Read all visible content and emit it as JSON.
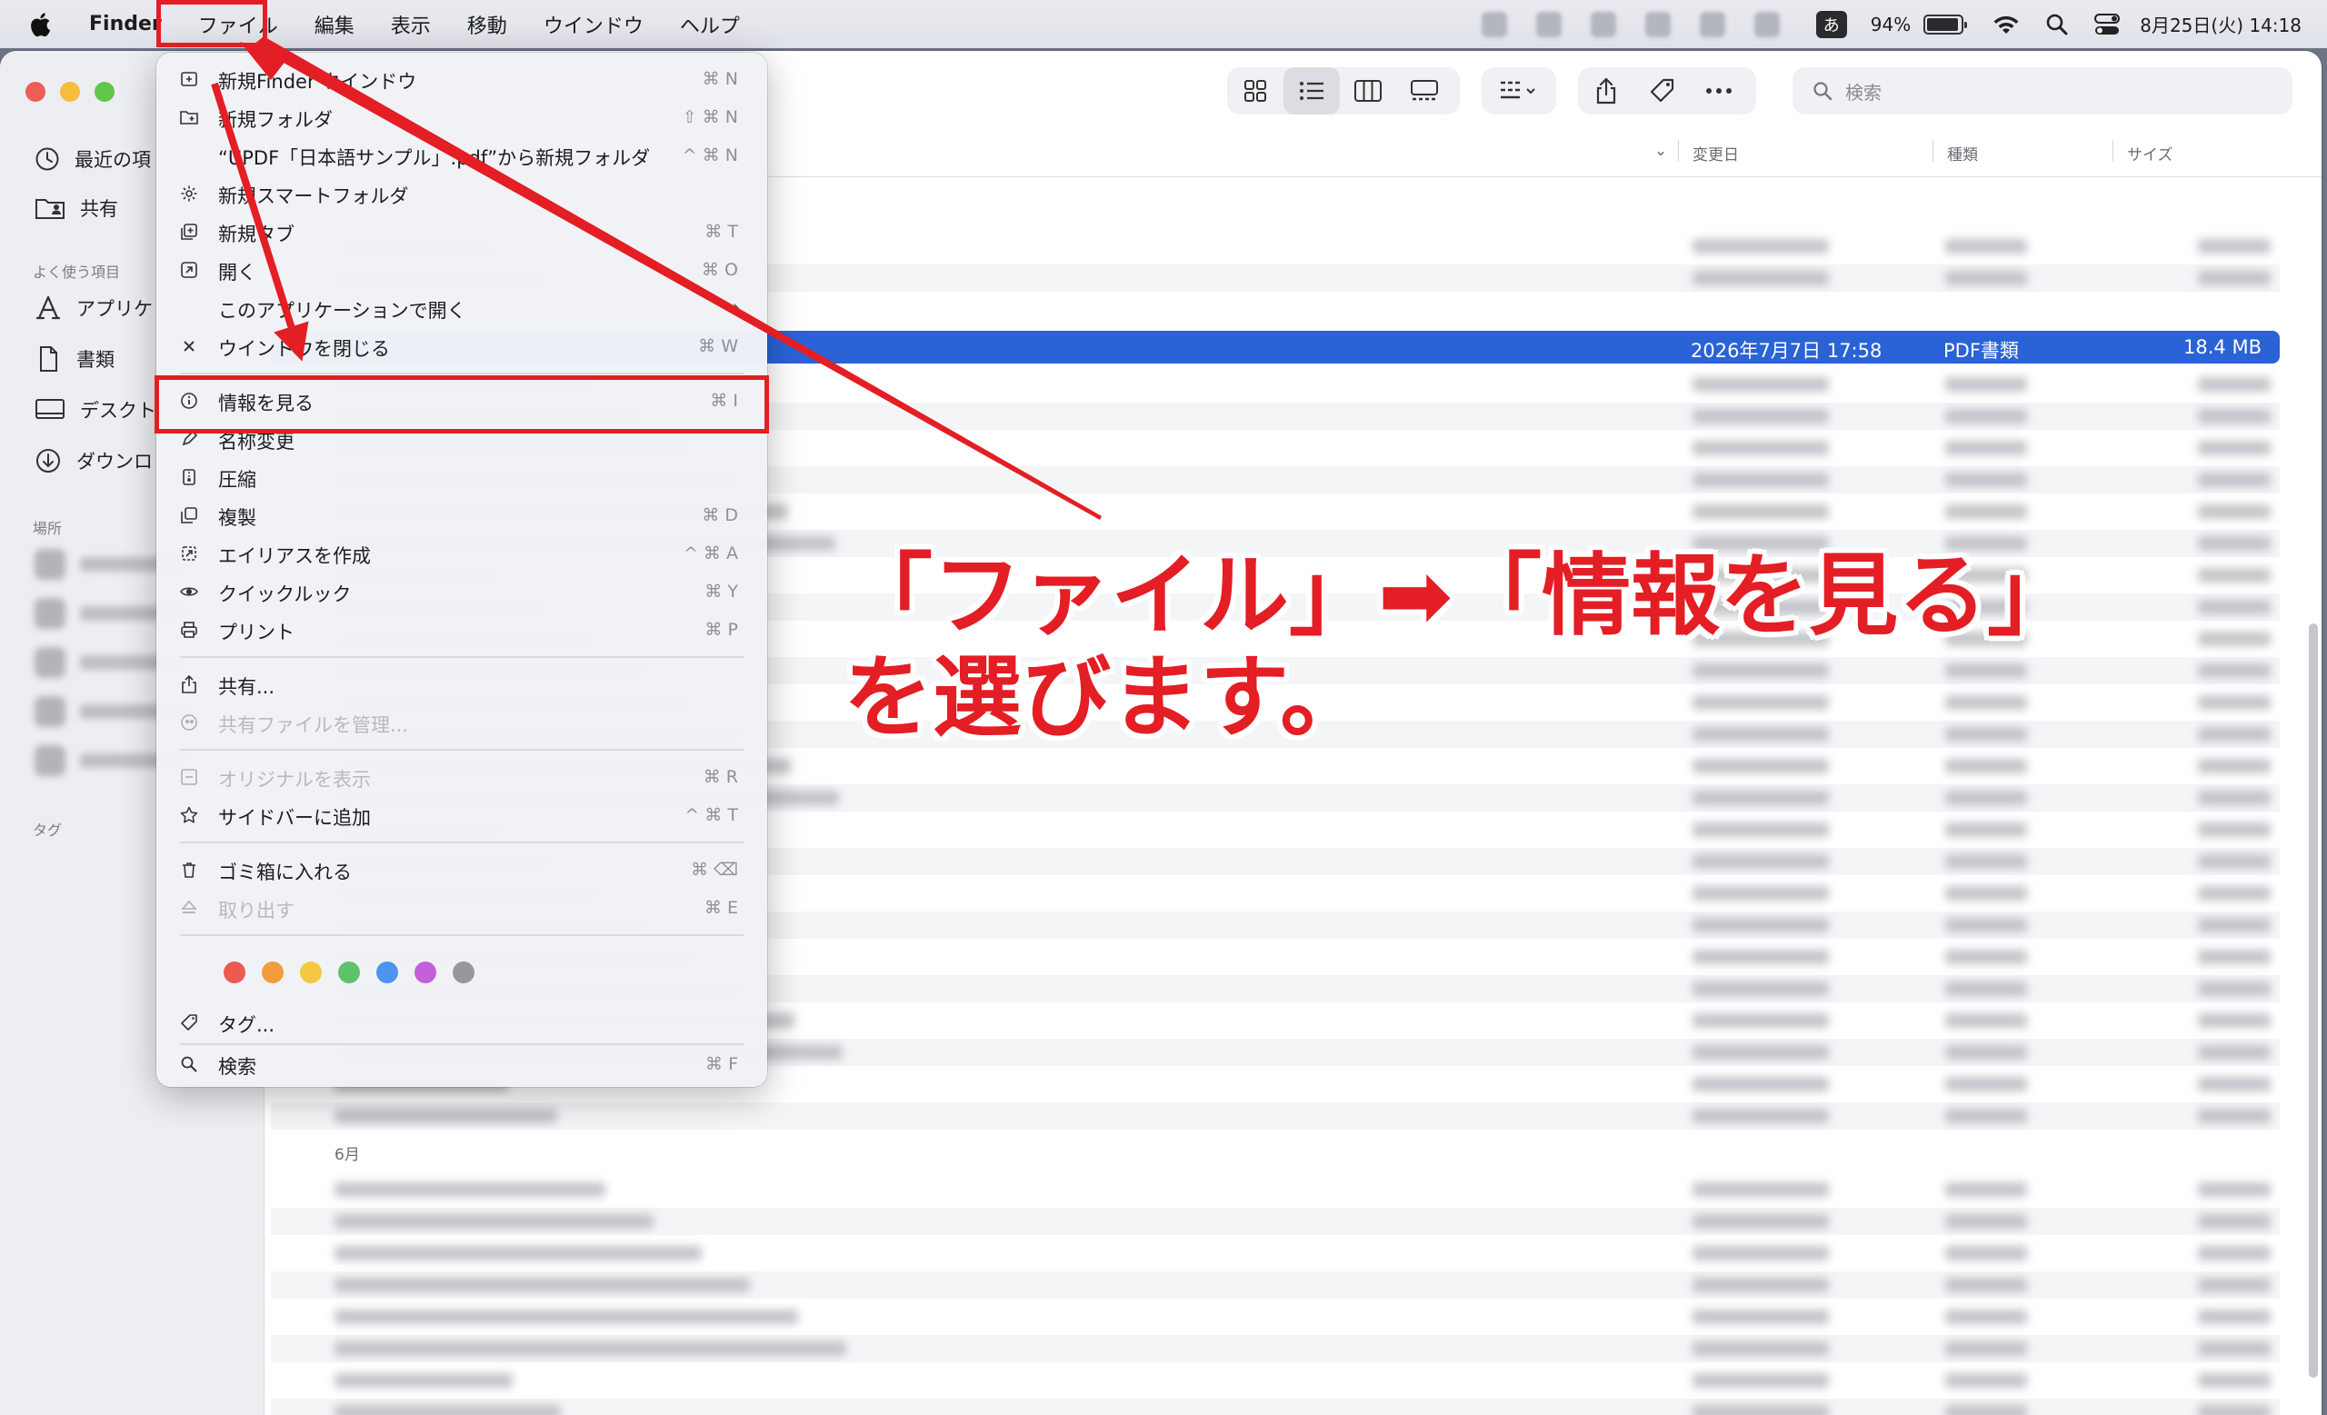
{
  "menubar": {
    "app": "Finder",
    "items": [
      "ファイル",
      "編集",
      "表示",
      "移動",
      "ウインドウ",
      "ヘルプ"
    ],
    "ime": "あ",
    "battery": "94%",
    "battery_level": 0.94,
    "datetime": "8月25日(火) 14:18"
  },
  "sidebar": {
    "items": [
      "最近の項",
      "共有"
    ],
    "favorites_header": "よく使う項目",
    "favorites": [
      "アプリケ",
      "書類",
      "デスクト",
      "ダウンロ"
    ],
    "locations_header": "場所",
    "tags_header": "タグ"
  },
  "toolbar": {
    "search_placeholder": "検索"
  },
  "columns": {
    "modified": "変更日",
    "kind": "種類",
    "size": "サイズ"
  },
  "selected_row": {
    "date": "2026年7月7日 17:58",
    "kind": "PDF書類",
    "size": "18.4 MB"
  },
  "group_label": "6月",
  "file_menu": {
    "items": [
      {
        "label": "新規Finder ウインドウ",
        "shortcut": "⌘ N"
      },
      {
        "label": "新規フォルダ",
        "shortcut": "⇧ ⌘ N"
      },
      {
        "label": "“UPDF「日本語サンプル」.pdf”から新規フォルダ",
        "shortcut": "^ ⌘ N"
      },
      {
        "label": "新規スマートフォルダ",
        "shortcut": ""
      },
      {
        "label": "新規タブ",
        "shortcut": "⌘ T"
      },
      {
        "label": "開く",
        "shortcut": "⌘ O"
      },
      {
        "label": "このアプリケーションで開く",
        "shortcut": ""
      },
      {
        "label": "ウインドウを閉じる",
        "shortcut": "⌘ W"
      },
      {
        "label": "情報を見る",
        "shortcut": "⌘ I"
      },
      {
        "label": "名称変更",
        "shortcut": ""
      },
      {
        "label": "圧縮",
        "shortcut": ""
      },
      {
        "label": "複製",
        "shortcut": "⌘ D"
      },
      {
        "label": "エイリアスを作成",
        "shortcut": "^ ⌘ A"
      },
      {
        "label": "クイックルック",
        "shortcut": "⌘ Y"
      },
      {
        "label": "プリント",
        "shortcut": "⌘ P"
      },
      {
        "label": "共有...",
        "shortcut": ""
      },
      {
        "label": "共有ファイルを管理...",
        "shortcut": ""
      },
      {
        "label": "オリジナルを表示",
        "shortcut": "⌘ R"
      },
      {
        "label": "サイドバーに追加",
        "shortcut": "^ ⌘ T"
      },
      {
        "label": "ゴミ箱に入れる",
        "shortcut": "⌘ ⌫"
      },
      {
        "label": "取り出す",
        "shortcut": "⌘ E"
      },
      {
        "label": "タグ...",
        "shortcut": ""
      },
      {
        "label": "検索",
        "shortcut": "⌘ F"
      }
    ],
    "tag_colors": [
      "#ec5a52",
      "#f39c3d",
      "#f5c842",
      "#5ec26a",
      "#4c94f0",
      "#c160d8",
      "#97989c"
    ]
  },
  "annotation": {
    "line1": "「ファイル」➡「情報を見る」",
    "line2": "を選びます。",
    "color": "#e31e24"
  }
}
